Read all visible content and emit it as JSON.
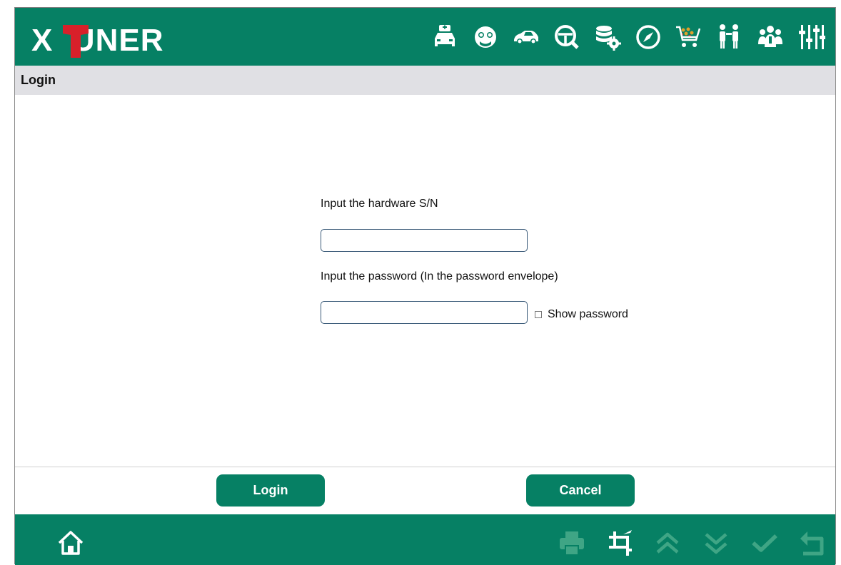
{
  "app": {
    "logo_text": "X  UNER"
  },
  "colors": {
    "brand": "#068064",
    "disabled": "#3fa585",
    "titlebar": "#e0e0e4"
  },
  "header": {
    "icons": [
      "car-doctor-icon",
      "mechanic-icon",
      "car-icon",
      "steering-search-icon",
      "database-settings-icon",
      "compass-icon",
      "shopping-cart-icon",
      "people-info-icon",
      "group-icon",
      "sliders-icon"
    ]
  },
  "page": {
    "title": "Login"
  },
  "form": {
    "sn_label": "Input the hardware S/N",
    "sn_value": "",
    "password_label": "Input the password (In the password envelope)",
    "password_value": "",
    "show_password_label": "Show password",
    "show_password_checked": false
  },
  "buttons": {
    "login": "Login",
    "cancel": "Cancel"
  },
  "footer": {
    "icons": [
      "home-icon",
      "print-icon",
      "crop-icon",
      "page-up-icon",
      "page-down-icon",
      "check-icon",
      "back-icon"
    ],
    "disabled": [
      "print-icon",
      "page-up-icon",
      "page-down-icon",
      "check-icon",
      "back-icon"
    ]
  }
}
